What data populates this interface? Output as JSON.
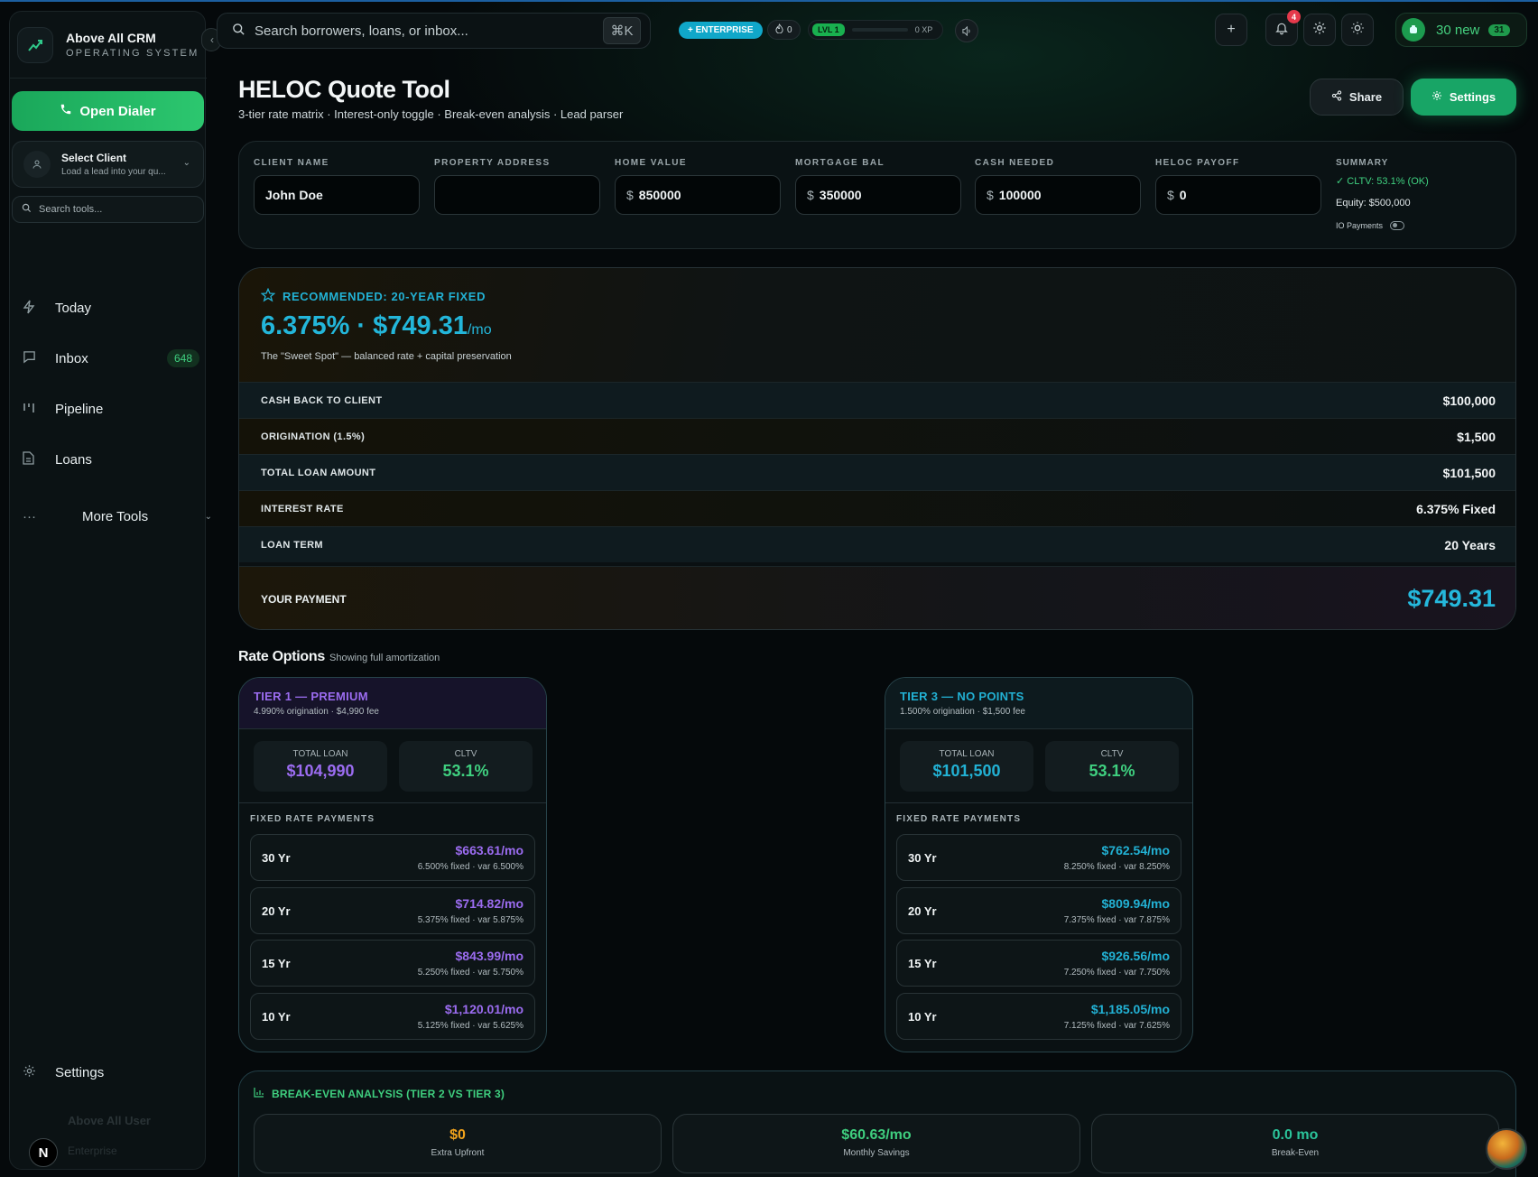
{
  "brand": {
    "name": "Above All CRM",
    "subtitle": "OPERATING SYSTEM"
  },
  "sidebar": {
    "dialer_label": "Open Dialer",
    "client_title": "Select Client",
    "client_sub": "Load a lead into your qu...",
    "tools_search_placeholder": "Search tools...",
    "items": [
      {
        "label": "Today",
        "icon": "bolt-icon"
      },
      {
        "label": "Inbox",
        "icon": "message-icon",
        "badge": "648"
      },
      {
        "label": "Pipeline",
        "icon": "pipeline-icon"
      },
      {
        "label": "Loans",
        "icon": "document-icon"
      }
    ],
    "more_label": "More Tools",
    "settings_label": "Settings",
    "user_name": "Above All User",
    "user_role": "Enterprise",
    "user_initial": "N"
  },
  "topbar": {
    "search_placeholder": "Search borrowers, loans, or inbox...",
    "shortcut": "⌘K",
    "plan_badge": "+ ENTERPRISE",
    "streak_count": "0",
    "level_label": "LVL 1",
    "level_progress": 0,
    "xp_label": "0 XP",
    "notifications_count": "4",
    "new_leads_label": "30 new",
    "new_leads_count": "31"
  },
  "page": {
    "title": "HELOC Quote Tool",
    "subtitle": "3-tier rate matrix · Interest-only toggle · Break-even analysis · Lead parser",
    "share_label": "Share",
    "settings_label": "Settings"
  },
  "form": {
    "fields": [
      {
        "label": "CLIENT NAME",
        "value": "John Doe",
        "prefix": ""
      },
      {
        "label": "PROPERTY ADDRESS",
        "value": "",
        "prefix": ""
      },
      {
        "label": "HOME VALUE",
        "value": "850000",
        "prefix": "$"
      },
      {
        "label": "MORTGAGE BAL",
        "value": "350000",
        "prefix": "$"
      },
      {
        "label": "CASH NEEDED",
        "value": "100000",
        "prefix": "$"
      },
      {
        "label": "HELOC PAYOFF",
        "value": "0",
        "prefix": "$"
      }
    ],
    "summary": {
      "title": "SUMMARY",
      "cltv": "CLTV: 53.1% (OK)",
      "equity": "Equity: $500,000",
      "io_label": "IO Payments",
      "io_enabled": false
    }
  },
  "recommended": {
    "label": "RECOMMENDED: 20-YEAR FIXED",
    "rate_payment": "6.375% · $749.31",
    "per": "/mo",
    "note": "The \"Sweet Spot\" — balanced rate + capital preservation",
    "rows": [
      {
        "label": "CASH BACK TO CLIENT",
        "value": "$100,000"
      },
      {
        "label": "ORIGINATION (1.5%)",
        "value": "$1,500"
      },
      {
        "label": "TOTAL LOAN AMOUNT",
        "value": "$101,500"
      },
      {
        "label": "INTEREST RATE",
        "value": "6.375% Fixed"
      },
      {
        "label": "LOAN TERM",
        "value": "20 Years"
      }
    ],
    "payment_label": "YOUR PAYMENT",
    "payment_value": "$749.31"
  },
  "rate_options": {
    "title": "Rate Options",
    "subtitle": "Showing full amortization",
    "tiers": [
      {
        "name": "TIER 1 — PREMIUM",
        "fee": "4.990% origination · $4,990 fee",
        "accent": "#9b6cf0",
        "total_loan_label": "TOTAL LOAN",
        "total_loan": "$104,990",
        "cltv_label": "CLTV",
        "cltv": "53.1%",
        "section_label": "FIXED RATE PAYMENTS",
        "terms": [
          {
            "term": "30 Yr",
            "payment": "$663.61/mo",
            "rates": "6.500% fixed · var 6.500%"
          },
          {
            "term": "20 Yr",
            "payment": "$714.82/mo",
            "rates": "5.375% fixed · var 5.875%"
          },
          {
            "term": "15 Yr",
            "payment": "$843.99/mo",
            "rates": "5.250% fixed · var 5.750%"
          },
          {
            "term": "10 Yr",
            "payment": "$1,120.01/mo",
            "rates": "5.125% fixed · var 5.625%"
          }
        ]
      },
      {
        "name": "TIER 3 — NO POINTS",
        "fee": "1.500% origination · $1,500 fee",
        "accent": "#22b1d4",
        "total_loan_label": "TOTAL LOAN",
        "total_loan": "$101,500",
        "cltv_label": "CLTV",
        "cltv": "53.1%",
        "section_label": "FIXED RATE PAYMENTS",
        "terms": [
          {
            "term": "30 Yr",
            "payment": "$762.54/mo",
            "rates": "8.250% fixed · var 8.250%"
          },
          {
            "term": "20 Yr",
            "payment": "$809.94/mo",
            "rates": "7.375% fixed · var 7.875%"
          },
          {
            "term": "15 Yr",
            "payment": "$926.56/mo",
            "rates": "7.250% fixed · var 7.750%"
          },
          {
            "term": "10 Yr",
            "payment": "$1,185.05/mo",
            "rates": "7.125% fixed · var 7.625%"
          }
        ]
      }
    ]
  },
  "break_even": {
    "title": "BREAK-EVEN ANALYSIS (TIER 2 VS TIER 3)",
    "items": [
      {
        "value": "$0",
        "label": "Extra Upfront",
        "color": "#f0a21c"
      },
      {
        "value": "$60.63/mo",
        "label": "Monthly Savings",
        "color": "#3fcf7f"
      },
      {
        "value": "0.0 mo",
        "label": "Break-Even",
        "color": "#2bc49a"
      }
    ]
  },
  "colors": {
    "accent_green": "#18a566",
    "accent_cyan": "#22b1d4",
    "accent_purple": "#9b6cf0",
    "badge_red": "#e5394b"
  }
}
